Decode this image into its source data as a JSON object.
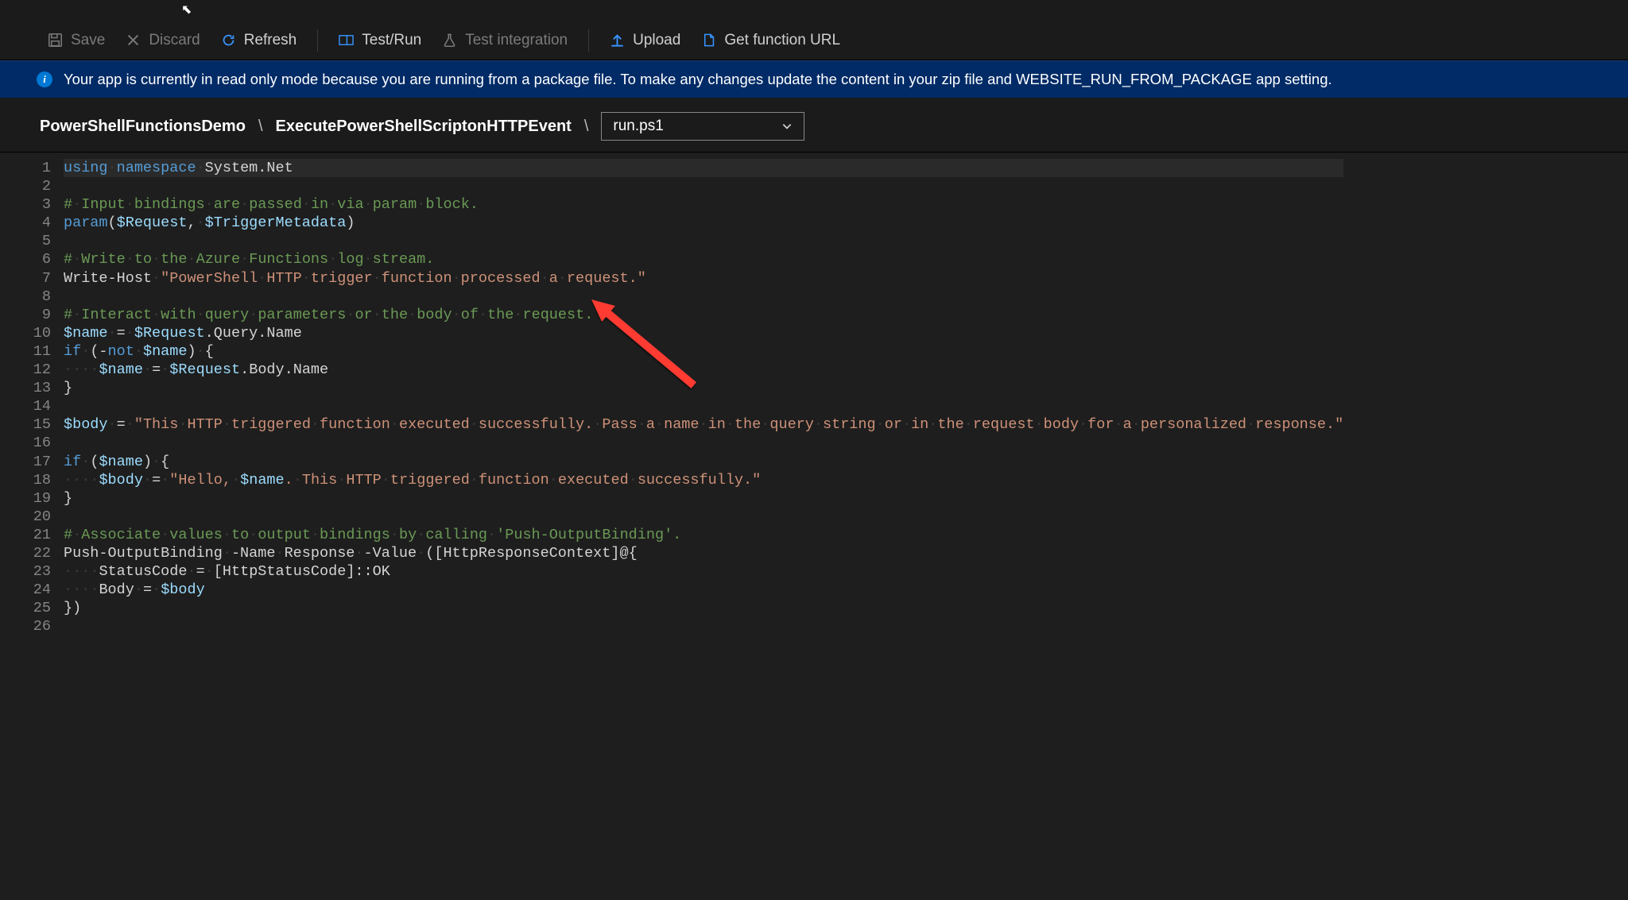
{
  "toolbar": {
    "save": "Save",
    "discard": "Discard",
    "refresh": "Refresh",
    "testrun": "Test/Run",
    "testint": "Test integration",
    "upload": "Upload",
    "geturl": "Get function URL"
  },
  "banner": {
    "text": "Your app is currently in read only mode because you are running from a package file. To make any changes update the content in your zip file and WEBSITE_RUN_FROM_PACKAGE app setting."
  },
  "breadcrumb": {
    "root": "PowerShellFunctionsDemo",
    "func": "ExecutePowerShellScriptonHTTPEvent",
    "file": "run.ps1"
  },
  "code_lines": [
    "using namespace System.Net",
    "",
    "# Input bindings are passed in via param block.",
    "param($Request, $TriggerMetadata)",
    "",
    "# Write to the Azure Functions log stream.",
    "Write-Host \"PowerShell HTTP trigger function processed a request.\"",
    "",
    "# Interact with query parameters or the body of the request.",
    "$name = $Request.Query.Name",
    "if (-not $name) {",
    "    $name = $Request.Body.Name",
    "}",
    "",
    "$body = \"This HTTP triggered function executed successfully. Pass a name in the query string or in the request body for a personalized response.\"",
    "",
    "if ($name) {",
    "    $body = \"Hello, $name. This HTTP triggered function executed successfully.\"",
    "}",
    "",
    "# Associate values to output bindings by calling 'Push-OutputBinding'.",
    "Push-OutputBinding -Name Response -Value ([HttpResponseContext]@{",
    "    StatusCode = [HttpStatusCode]::OK",
    "    Body = $body",
    "})",
    ""
  ]
}
